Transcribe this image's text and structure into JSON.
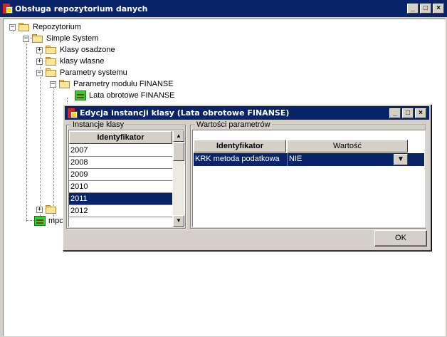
{
  "main_window": {
    "title": "Obsługa repozytorium danych",
    "buttons": {
      "minimize": "_",
      "maximize": "□",
      "close": "×"
    }
  },
  "tree": {
    "root": "Repozytorium",
    "simple_system": "Simple System",
    "klasy_osadzone": "Klasy osadzone",
    "klasy_wlasne": "klasy wlasne",
    "parametry_systemu": "Parametry systemu",
    "parametry_modulu": "Parametry modułu FINANSE",
    "lata_obrotowe": "Lata obrotowe FINANSE",
    "partial_item": "mpc"
  },
  "dialog": {
    "title": "Edycja instancji klasy (Lata obrotowe FINANSE)",
    "instances_group": "Instancje klasy",
    "instances_header": "Identyfikator",
    "instances": [
      "2007",
      "2008",
      "2009",
      "2010",
      "2011",
      "2012"
    ],
    "selected_instance": "2011",
    "params_group": "Wartości parametrów",
    "params_headers": {
      "id": "Identyfikator",
      "value": "Wartość"
    },
    "params": [
      {
        "id": "KRK metoda podatkowa",
        "value": "NIE"
      }
    ],
    "ok_label": "OK"
  }
}
